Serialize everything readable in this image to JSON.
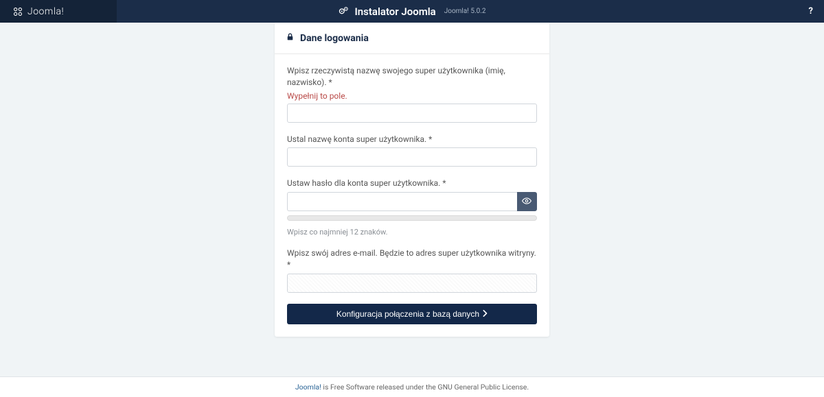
{
  "topbar": {
    "logo_text": "Joomla!",
    "title": "Instalator Joomla",
    "version": "Joomla! 5.0.2",
    "help_symbol": "?"
  },
  "card": {
    "heading": "Dane logowania"
  },
  "fields": {
    "realname": {
      "label": "Wpisz rzeczywistą nazwę swojego super użytkownika (imię, nazwisko). *",
      "error": "Wypełnij to pole.",
      "value": ""
    },
    "username": {
      "label": "Ustal nazwę konta super użytkownika. *",
      "value": ""
    },
    "password": {
      "label": "Ustaw hasło dla konta super użytkownika. *",
      "value": "",
      "hint": "Wpisz co najmniej 12 znaków."
    },
    "email": {
      "label": "Wpisz swój adres e-mail. Będzie to adres super użytkownika witryny. *",
      "value": ""
    }
  },
  "button": {
    "label": "Konfiguracja połączenia z bazą danych"
  },
  "footer": {
    "brand": "Joomla!",
    "text": " is Free Software released under the GNU General Public License."
  }
}
